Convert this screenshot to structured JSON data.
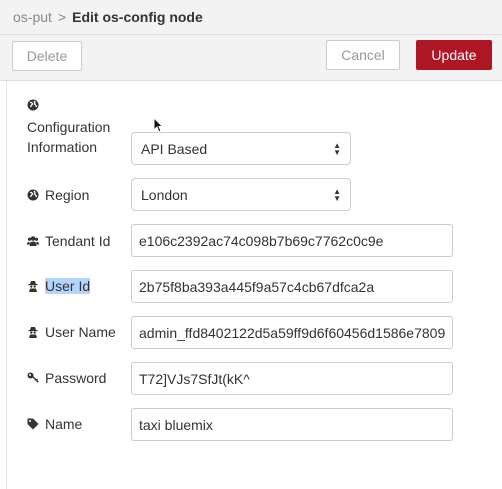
{
  "header": {
    "parent": "os-put",
    "separator": ">",
    "title": "Edit os-config node"
  },
  "toolbar": {
    "delete_label": "Delete",
    "cancel_label": "Cancel",
    "update_label": "Update"
  },
  "colors": {
    "update_bg": "#ad1625",
    "header_bg": "#f3f3f3",
    "selection": "#b3d4fc"
  },
  "form": {
    "config": {
      "label_line1": "Configuration",
      "label_line2": "Information",
      "value": "API Based",
      "icon": "globe-icon"
    },
    "region": {
      "label": "Region",
      "value": "London",
      "icon": "globe-icon"
    },
    "tenant": {
      "label": "Tendant Id",
      "value": "e106c2392ac74c098b7b69c7762c0c9e",
      "icon": "users-icon"
    },
    "userid": {
      "label": "User Id",
      "value": "2b75f8ba393a445f9a57c4cb67dfca2a",
      "icon": "user-secret-icon"
    },
    "username": {
      "label": "User Name",
      "value": "admin_ffd8402122d5a59ff9d6f60456d1586e7809",
      "icon": "user-secret-icon"
    },
    "password": {
      "label": "Password",
      "value": "T72]VJs7SfJt(kK^",
      "icon": "key-icon"
    },
    "name": {
      "label": "Name",
      "value": "taxi bluemix",
      "icon": "tag-icon"
    }
  }
}
